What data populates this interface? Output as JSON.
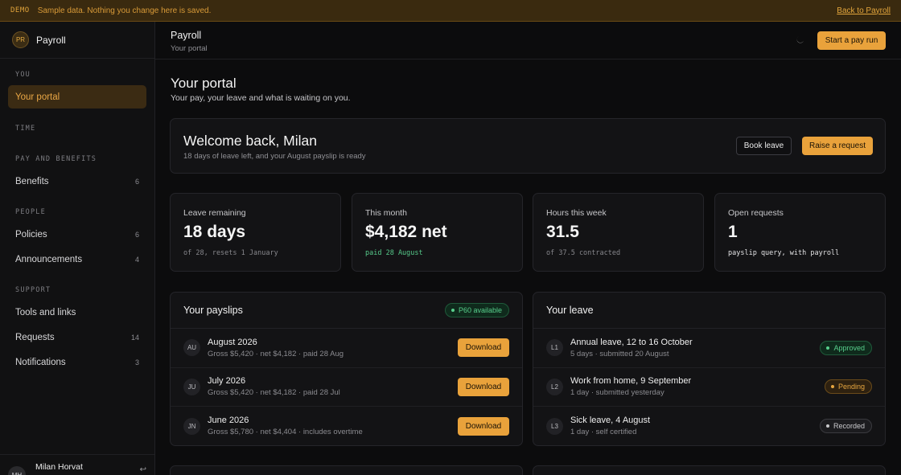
{
  "banner": {
    "tag": "DEMO",
    "message": "Sample data. Nothing you change here is saved.",
    "back_link": "Back to Payroll"
  },
  "brand": {
    "badge": "PR",
    "name": "Payroll"
  },
  "sidebar": {
    "sections": [
      {
        "label": "YOU",
        "items": [
          {
            "label": "Your portal",
            "count": "",
            "active": true
          }
        ]
      },
      {
        "label": "TIME",
        "items": []
      },
      {
        "label": "PAY AND BENEFITS",
        "items": [
          {
            "label": "Benefits",
            "count": "6"
          }
        ]
      },
      {
        "label": "PEOPLE",
        "items": [
          {
            "label": "Policies",
            "count": "6"
          },
          {
            "label": "Announcements",
            "count": "4"
          }
        ]
      },
      {
        "label": "SUPPORT",
        "items": [
          {
            "label": "Tools and links",
            "count": ""
          },
          {
            "label": "Requests",
            "count": "14"
          },
          {
            "label": "Notifications",
            "count": "3"
          }
        ]
      }
    ],
    "user": {
      "initials": "MH",
      "name": "Milan Horvat"
    }
  },
  "header": {
    "title": "Payroll",
    "subtitle": "Your portal",
    "primary_action": "Start a pay run"
  },
  "page": {
    "title": "Your portal",
    "subtitle": "Your pay, your leave and what is waiting on you."
  },
  "welcome": {
    "title": "Welcome back, Milan",
    "subtitle": "18 days of leave left, and your August payslip is ready",
    "book_leave": "Book leave",
    "raise_request": "Raise a request"
  },
  "stats": [
    {
      "label": "Leave remaining",
      "value": "18 days",
      "note": "of 28, resets 1 January",
      "tone": "muted"
    },
    {
      "label": "This month",
      "value": "$4,182 net",
      "note": "paid 28 August",
      "tone": "green"
    },
    {
      "label": "Hours this week",
      "value": "31.5",
      "note": "of 37.5 contracted",
      "tone": "muted"
    },
    {
      "label": "Open requests",
      "value": "1",
      "note": "payslip query, with payroll",
      "tone": "white"
    }
  ],
  "payslips": {
    "title": "Your payslips",
    "badge": "P60 available",
    "download_label": "Download",
    "rows": [
      {
        "initials": "AU",
        "title": "August 2026",
        "detail": "Gross $5,420 · net $4,182 · paid 28 Aug"
      },
      {
        "initials": "JU",
        "title": "July 2026",
        "detail": "Gross $5,420 · net $4,182 · paid 28 Jul"
      },
      {
        "initials": "JN",
        "title": "June 2026",
        "detail": "Gross $5,780 · net $4,404 · includes overtime"
      }
    ]
  },
  "leave": {
    "title": "Your leave",
    "rows": [
      {
        "initials": "L1",
        "title": "Annual leave, 12 to 16 October",
        "detail": "5 days · submitted 20 August",
        "status": "Approved",
        "tone": "green"
      },
      {
        "initials": "L2",
        "title": "Work from home, 9 September",
        "detail": "1 day · submitted yesterday",
        "status": "Pending",
        "tone": "amber"
      },
      {
        "initials": "L3",
        "title": "Sick leave, 4 August",
        "detail": "1 day · self certified",
        "status": "Recorded",
        "tone": "grey"
      }
    ]
  }
}
